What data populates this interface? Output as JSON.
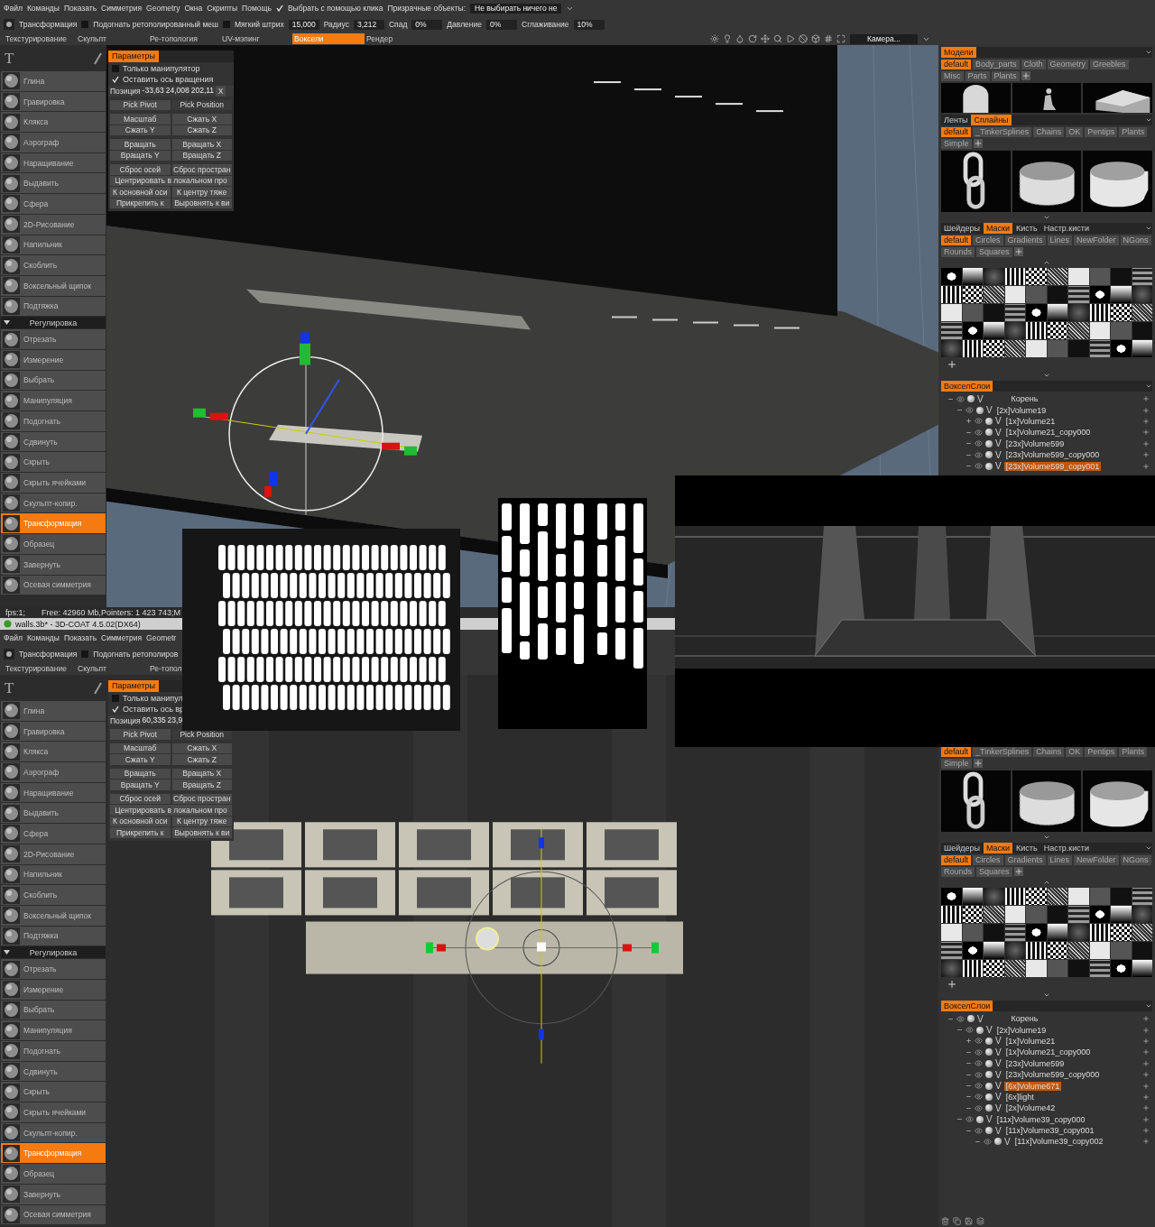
{
  "windows": [
    {
      "menu": {
        "items": [
          "Файл",
          "Команды",
          "Показать",
          "Симметрия",
          "Geometry",
          "Окна",
          "Скрипты",
          "Помощь"
        ],
        "click_select": {
          "label": "Выбрать с помощью клика",
          "checked": true
        },
        "ghost_label": "Призрачные объекты:",
        "ghost_value": "Не выбирать ничего не"
      },
      "toolbar": {
        "tool": "Трансформация",
        "fit": {
          "label": "Подогнать ретополированный меш",
          "checked": false
        },
        "soft": {
          "label": "Мягкий штрих",
          "checked": false,
          "value": "15,000"
        },
        "params": [
          {
            "label": "Радиус",
            "value": "3,212"
          },
          {
            "label": "Спад",
            "value": "0%"
          },
          {
            "label": "Давление",
            "value": "0%"
          },
          {
            "label": "Сглаживание",
            "value": "10%"
          }
        ]
      },
      "rooms": [
        {
          "label": "Текстурирование",
          "selected": false
        },
        {
          "label": "Скульпт",
          "selected": false
        },
        {
          "label": "Ре-топология",
          "selected": false
        },
        {
          "label": "UV-мэпинг",
          "selected": false
        },
        {
          "label": "Воксели",
          "selected": true
        },
        {
          "label": "Рендер",
          "selected": false
        }
      ],
      "camera": "Камера...",
      "glyph": "T",
      "tools": [
        {
          "kind": "tool",
          "label": "Глина",
          "selected": false
        },
        {
          "kind": "tool",
          "label": "Гравировка",
          "selected": false
        },
        {
          "kind": "tool",
          "label": "Клякса",
          "selected": false
        },
        {
          "kind": "tool",
          "label": "Аэрограф",
          "selected": false
        },
        {
          "kind": "tool",
          "label": "Наращивание",
          "selected": false
        },
        {
          "kind": "tool",
          "label": "Выдавить",
          "selected": false
        },
        {
          "kind": "tool",
          "label": "Сфера",
          "selected": false
        },
        {
          "kind": "tool",
          "label": "2D-Рисование",
          "selected": false
        },
        {
          "kind": "tool",
          "label": "Напильник",
          "selected": false
        },
        {
          "kind": "tool",
          "label": "Скоблить",
          "selected": false
        },
        {
          "kind": "tool",
          "label": "Воксельный щипок",
          "selected": false
        },
        {
          "kind": "tool",
          "label": "Подтяжка",
          "selected": false
        },
        {
          "kind": "section",
          "label": "Регулировка"
        },
        {
          "kind": "tool",
          "label": "Отрезать",
          "selected": false
        },
        {
          "kind": "tool",
          "label": "Измерение",
          "selected": false
        },
        {
          "kind": "tool",
          "label": "Выбрать",
          "selected": false
        },
        {
          "kind": "tool",
          "label": "Манипуляция",
          "selected": false
        },
        {
          "kind": "tool",
          "label": "Подогнать",
          "selected": false
        },
        {
          "kind": "tool",
          "label": "Сдвинуть",
          "selected": false
        },
        {
          "kind": "tool",
          "label": "Скрыть",
          "selected": false
        },
        {
          "kind": "tool",
          "label": "Скрыть ячейками",
          "selected": false
        },
        {
          "kind": "tool",
          "label": "Скульпт-копир.",
          "selected": false
        },
        {
          "kind": "tool",
          "label": "Трансформация",
          "selected": true
        },
        {
          "kind": "tool",
          "label": "Образец",
          "selected": false
        },
        {
          "kind": "tool",
          "label": "Завернуть",
          "selected": false
        },
        {
          "kind": "tool",
          "label": "Осевая симметрия",
          "selected": false
        }
      ],
      "params": {
        "tab": "Параметры",
        "selected": true,
        "checks": [
          {
            "label": "Только манипулятор",
            "checked": false
          },
          {
            "label": "Оставить ось вращения",
            "checked": true
          }
        ],
        "position": {
          "label": "Позиция",
          "values": [
            "-33,63",
            "24,008",
            "202,11"
          ],
          "clear": "X"
        },
        "pick": "Pick Pivot",
        "pick_mode": "Pick Position",
        "groups": [
          [
            {
              "label": "Масштаб",
              "kind": "half"
            },
            {
              "label": "Сжать X",
              "kind": "half"
            },
            {
              "label": "Сжать Y",
              "kind": "half"
            },
            {
              "label": "Сжать Z",
              "kind": "half"
            }
          ],
          [
            {
              "label": "Вращать",
              "kind": "half"
            },
            {
              "label": "Вращать X",
              "kind": "half"
            },
            {
              "label": "Вращать Y",
              "kind": "half"
            },
            {
              "label": "Вращать Z",
              "kind": "half"
            }
          ],
          [
            {
              "label": "Сброс осей",
              "kind": "half"
            },
            {
              "label": "Сброс простран",
              "kind": "half"
            },
            {
              "label": "Центрировать в локальном про",
              "kind": "wide"
            },
            {
              "label": "К основной оси",
              "kind": "half"
            },
            {
              "label": "К центру тяже",
              "kind": "half"
            },
            {
              "label": "Прикрепить к",
              "kind": "half"
            },
            {
              "label": "Выровнять к ви",
              "kind": "half"
            }
          ]
        ]
      },
      "panels": [
        {
          "kind": "models",
          "tabs": [
            {
              "label": "Модели",
              "selected": true
            }
          ],
          "tags": [
            {
              "label": "default",
              "selected": true
            },
            {
              "label": "Body_parts",
              "selected": false
            },
            {
              "label": "Cloth",
              "selected": false
            },
            {
              "label": "Geometry",
              "selected": false
            },
            {
              "label": "Greebles",
              "selected": false
            },
            {
              "label": "Misc",
              "selected": false
            },
            {
              "label": "Parts",
              "selected": false
            },
            {
              "label": "Plants",
              "selected": false
            }
          ]
        },
        {
          "kind": "splines",
          "tabs": [
            {
              "label": "Ленты",
              "selected": false
            },
            {
              "label": "Сплайны",
              "selected": true
            }
          ],
          "tags": [
            {
              "label": "default",
              "selected": true
            },
            {
              "label": "_TinkerSplines",
              "selected": false
            },
            {
              "label": "Chains",
              "selected": false
            },
            {
              "label": "OK",
              "selected": false
            },
            {
              "label": "Pentips",
              "selected": false
            },
            {
              "label": "Plants",
              "selected": false
            },
            {
              "label": "Simple",
              "selected": false
            }
          ]
        },
        {
          "kind": "masks",
          "tabs": [
            {
              "label": "Шейдеры",
              "selected": false
            },
            {
              "label": "Маски",
              "selected": true
            },
            {
              "label": "Кисть",
              "selected": false
            },
            {
              "label": "Настр.кисти",
              "selected": false
            }
          ],
          "tags": [
            {
              "label": "default",
              "selected": true
            },
            {
              "label": "Circles",
              "selected": false
            },
            {
              "label": "Gradients",
              "selected": false
            },
            {
              "label": "Lines",
              "selected": false
            },
            {
              "label": "NewFolder",
              "selected": false
            },
            {
              "label": "NGons",
              "selected": false
            },
            {
              "label": "Rounds",
              "selected": false
            },
            {
              "label": "Squares",
              "selected": false
            }
          ]
        },
        {
          "kind": "layers",
          "tabs": [
            {
              "label": "ВокселСлои",
              "selected": true
            }
          ],
          "tree": {
            "label": "Корень",
            "flag": "V",
            "expanded": true,
            "selected": false,
            "children": [
              {
                "label": "[2x]Volume19",
                "flag": "V",
                "expanded": true,
                "selected": false,
                "children": [
                  {
                    "label": "[1x]Volume21",
                    "flag": "V",
                    "expanded": false,
                    "selected": false
                  },
                  {
                    "label": "[1x]Volume21_copy000",
                    "flag": "V",
                    "expanded": true,
                    "selected": false
                  },
                  {
                    "label": "[23x]Volume599",
                    "flag": "V",
                    "expanded": true,
                    "selected": false
                  },
                  {
                    "label": "[23x]Volume599_copy000",
                    "flag": "V",
                    "expanded": true,
                    "selected": false
                  },
                  {
                    "label": "[23x]Volume599_copy001",
                    "flag": "V",
                    "expanded": true,
                    "selected": true
                  }
                ]
              }
            ]
          }
        }
      ],
      "status": [
        "fps:1;",
        "Free: 42960 Mb,Pointers: 1 423 743;M"
      ]
    },
    {
      "title": "walls.3b* - 3D-COAT 4.5.02(DX64)",
      "menu": {
        "items": [
          "Файл",
          "Команды",
          "Показать",
          "Симметрия",
          "Geometr"
        ]
      },
      "toolbar": {
        "tool": "Трансформация",
        "fit": {
          "label": "Подогнать ретополиров",
          "checked": false
        }
      },
      "rooms": [
        {
          "label": "Текстурирование",
          "selected": false
        },
        {
          "label": "Скульпт",
          "selected": false
        },
        {
          "label": "Ре-топол",
          "selected": false
        }
      ],
      "glyph": "T",
      "tools": [
        {
          "kind": "tool",
          "label": "Глина",
          "selected": false
        },
        {
          "kind": "tool",
          "label": "Гравировка",
          "selected": false
        },
        {
          "kind": "tool",
          "label": "Клякса",
          "selected": false
        },
        {
          "kind": "tool",
          "label": "Аэрограф",
          "selected": false
        },
        {
          "kind": "tool",
          "label": "Наращивание",
          "selected": false
        },
        {
          "kind": "tool",
          "label": "Выдавить",
          "selected": false
        },
        {
          "kind": "tool",
          "label": "Сфера",
          "selected": false
        },
        {
          "kind": "tool",
          "label": "2D-Рисование",
          "selected": false
        },
        {
          "kind": "tool",
          "label": "Напильник",
          "selected": false
        },
        {
          "kind": "tool",
          "label": "Скоблить",
          "selected": false
        },
        {
          "kind": "tool",
          "label": "Воксельный щипок",
          "selected": false
        },
        {
          "kind": "tool",
          "label": "Подтяжка",
          "selected": false
        },
        {
          "kind": "section",
          "label": "Регулировка"
        },
        {
          "kind": "tool",
          "label": "Отрезать",
          "selected": false
        },
        {
          "kind": "tool",
          "label": "Измерение",
          "selected": false
        },
        {
          "kind": "tool",
          "label": "Выбрать",
          "selected": false
        },
        {
          "kind": "tool",
          "label": "Манипуляция",
          "selected": false
        },
        {
          "kind": "tool",
          "label": "Подогнать",
          "selected": false
        },
        {
          "kind": "tool",
          "label": "Сдвинуть",
          "selected": false
        },
        {
          "kind": "tool",
          "label": "Скрыть",
          "selected": false
        },
        {
          "kind": "tool",
          "label": "Скрыть ячейками",
          "selected": false
        },
        {
          "kind": "tool",
          "label": "Скульпт-копир.",
          "selected": false
        },
        {
          "kind": "tool",
          "label": "Трансформация",
          "selected": true
        },
        {
          "kind": "tool",
          "label": "Образец",
          "selected": false
        },
        {
          "kind": "tool",
          "label": "Завернуть",
          "selected": false
        },
        {
          "kind": "tool",
          "label": "Осевая симметрия",
          "selected": false
        }
      ],
      "params": {
        "tab": "Параметры",
        "selected": true,
        "checks": [
          {
            "label": "Только манипул",
            "checked": false
          },
          {
            "label": "Оставить ось вр",
            "checked": true
          }
        ],
        "position": {
          "label": "Позиция",
          "values": [
            "60,335",
            "23,9"
          ]
        },
        "pick": "Pick Pivot",
        "pick_mode": "Pick Position",
        "groups": [
          [
            {
              "label": "Масштаб",
              "kind": "half"
            },
            {
              "label": "Сжать X",
              "kind": "half"
            },
            {
              "label": "Сжать Y",
              "kind": "half"
            },
            {
              "label": "Сжать Z",
              "kind": "half"
            }
          ],
          [
            {
              "label": "Вращать",
              "kind": "half"
            },
            {
              "label": "Вращать X",
              "kind": "half"
            },
            {
              "label": "Вращать Y",
              "kind": "half"
            },
            {
              "label": "Вращать Z",
              "kind": "half"
            }
          ],
          [
            {
              "label": "Сброс осей",
              "kind": "half"
            },
            {
              "label": "Сброс простран",
              "kind": "half"
            },
            {
              "label": "Центрировать в локальном про",
              "kind": "wide"
            },
            {
              "label": "К основной оси",
              "kind": "half"
            },
            {
              "label": "К центру тяже",
              "kind": "half"
            },
            {
              "label": "Прикрепить к",
              "kind": "half"
            },
            {
              "label": "Выровнять к ви",
              "kind": "half"
            }
          ]
        ]
      },
      "panels": [
        {
          "kind": "splines",
          "tags": [
            {
              "label": "default",
              "selected": true
            },
            {
              "label": "_TinkerSplines",
              "selected": false
            },
            {
              "label": "Chains",
              "selected": false
            },
            {
              "label": "OK",
              "selected": false
            },
            {
              "label": "Pentips",
              "selected": false
            },
            {
              "label": "Plants",
              "selected": false
            },
            {
              "label": "Simple",
              "selected": false
            }
          ]
        },
        {
          "kind": "masks",
          "tabs": [
            {
              "label": "Шейдеры",
              "selected": false
            },
            {
              "label": "Маски",
              "selected": true
            },
            {
              "label": "Кисть",
              "selected": false
            },
            {
              "label": "Настр.кисти",
              "selected": false
            }
          ],
          "tags": [
            {
              "label": "default",
              "selected": true
            },
            {
              "label": "Circles",
              "selected": false
            },
            {
              "label": "Gradients",
              "selected": false
            },
            {
              "label": "Lines",
              "selected": false
            },
            {
              "label": "NewFolder",
              "selected": false
            },
            {
              "label": "NGons",
              "selected": false
            },
            {
              "label": "Rounds",
              "selected": false
            },
            {
              "label": "Squares",
              "selected": false
            }
          ]
        },
        {
          "kind": "layers",
          "tabs": [
            {
              "label": "ВокселСлои",
              "selected": true
            }
          ],
          "tree": {
            "label": "Корень",
            "flag": "V",
            "expanded": true,
            "selected": false,
            "children": [
              {
                "label": "[2x]Volume19",
                "flag": "V",
                "expanded": true,
                "selected": false,
                "children": [
                  {
                    "label": "[1x]Volume21",
                    "flag": "V",
                    "expanded": false,
                    "selected": false
                  },
                  {
                    "label": "[1x]Volume21_copy000",
                    "flag": "V",
                    "expanded": true,
                    "selected": false
                  },
                  {
                    "label": "[23x]Volume599",
                    "flag": "V",
                    "expanded": true,
                    "selected": false
                  },
                  {
                    "label": "[23x]Volume599_copy000",
                    "flag": "V",
                    "expanded": true,
                    "selected": false
                  },
                  {
                    "label": "[6x]Volume671",
                    "flag": "V",
                    "expanded": true,
                    "selected": true
                  },
                  {
                    "label": "[6x]light",
                    "flag": "V",
                    "expanded": true,
                    "selected": false
                  },
                  {
                    "label": "[2x]Volume42",
                    "flag": "V",
                    "expanded": true,
                    "selected": false
                  }
                ]
              },
              {
                "label": "[11x]Volume39_copy000",
                "flag": "V",
                "expanded": true,
                "selected": false,
                "children": [
                  {
                    "label": "[11x]Volume39_copy001",
                    "flag": "V",
                    "expanded": true,
                    "selected": false,
                    "children": [
                      {
                        "label": "[11x]Volume39_copy002",
                        "flag": "V",
                        "expanded": true,
                        "selected": false
                      }
                    ]
                  }
                ]
              }
            ]
          }
        }
      ]
    }
  ]
}
